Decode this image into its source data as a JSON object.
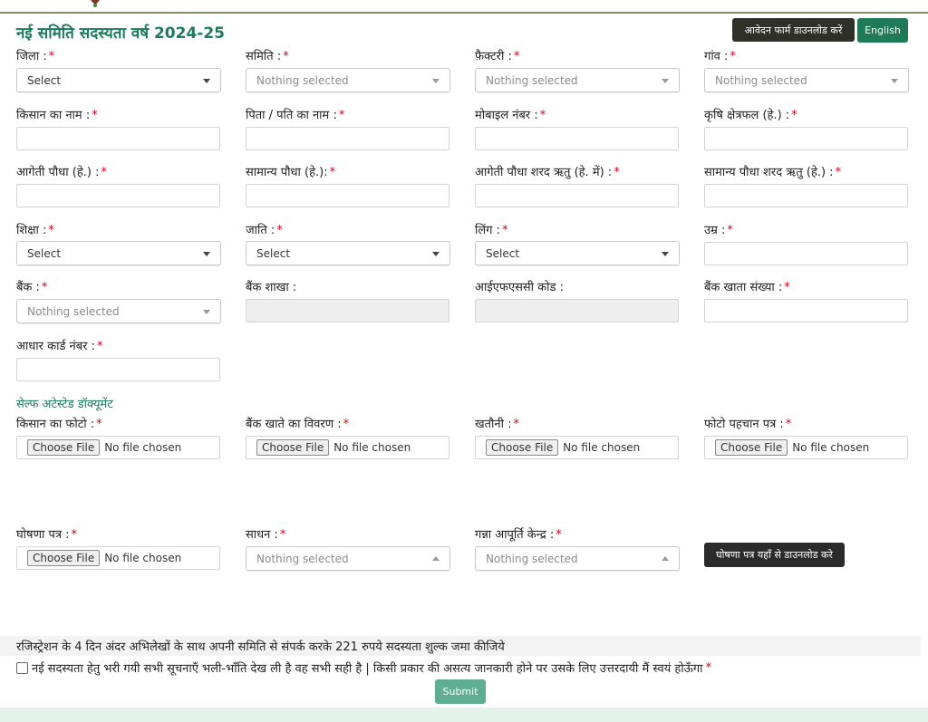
{
  "header": {
    "title": "नई समिति सदस्यता वर्ष 2024-25",
    "download_form_button": "आवेदन फार्म डाउनलोड करें",
    "language_button": "English"
  },
  "fields": {
    "district": {
      "label": "जिला :",
      "value": "Select"
    },
    "committee": {
      "label": "समिति :",
      "value": "Nothing selected"
    },
    "factory": {
      "label": "फ़ैक्टरी :",
      "value": "Nothing selected"
    },
    "village": {
      "label": "गांव :",
      "value": "Nothing selected"
    },
    "farmer_name": {
      "label": "किसान का नाम :"
    },
    "father_husband_name": {
      "label": "पिता / पति का नाम :"
    },
    "mobile": {
      "label": "मोबाइल नंबर :"
    },
    "agri_area": {
      "label": "कृषि क्षेत्रफल (हे.) :"
    },
    "early_plant": {
      "label": "आगेती पौधा (हे.) :"
    },
    "general_plant": {
      "label": "सामान्य पौधा (हे.):"
    },
    "early_plant_autumn": {
      "label": "आगेती पौधा शरद ऋतु (हे. में) :"
    },
    "general_plant_autumn": {
      "label": "सामान्य पौधा शरद ऋतु (हे.) :"
    },
    "education": {
      "label": "शिक्षा :",
      "value": "Select"
    },
    "caste": {
      "label": "जाति :",
      "value": "Select"
    },
    "gender": {
      "label": "लिंग :",
      "value": "Select"
    },
    "age": {
      "label": "उम्र :"
    },
    "bank": {
      "label": "बैंक :",
      "value": "Nothing selected"
    },
    "bank_branch": {
      "label": "बैंक शाखा :"
    },
    "ifsc": {
      "label": "आईएफएससी कोड :"
    },
    "account_number": {
      "label": "बैंक खाता संख्या :"
    },
    "aadhaar": {
      "label": "आधार कार्ड नंबर :"
    }
  },
  "documents": {
    "section_title": "सेल्फ अटेस्टेड डॉक्यूमेंट",
    "farmer_photo": {
      "label": "किसान का फोटो :"
    },
    "bank_details": {
      "label": "बैंक खाते का विवरण :"
    },
    "khatauni": {
      "label": "खतौनी :"
    },
    "photo_id": {
      "label": "फोटो पहचान पत्र :"
    },
    "declaration_doc": {
      "label": "घोषणा पत्र :"
    },
    "choose_file": "Choose File",
    "no_file": "No file chosen"
  },
  "misc": {
    "resource": {
      "label": "साधन :",
      "value": "Nothing selected"
    },
    "supply_center": {
      "label": "गन्ना आपूर्ति केन्द्र :",
      "value": "Nothing selected"
    },
    "declaration_download_button": "घोषणा पत्र यहाँ से डाउनलोड करे"
  },
  "required_mark": "*",
  "notice": "रजिस्ट्रेशन के 4 दिन अंदर अभिलेखों के साथ अपनी समिति से संपर्क करके 221 रुपये सदस्यता शुल्क जमा कीजिये",
  "declaration_text": "नई सदस्यता हेतु भरी गयी सभी सूचनाएँ भली-भाँति देख ली है वह सभी सही है | किसी प्रकार की असत्य जानकारी होने पर उसके लिए उत्तरदायी मैं स्वयं होऊँगा",
  "submit_label": "Submit",
  "colors": {
    "accent": "#1c7b5a",
    "required": "#d0021b",
    "submit": "#5fae93"
  }
}
